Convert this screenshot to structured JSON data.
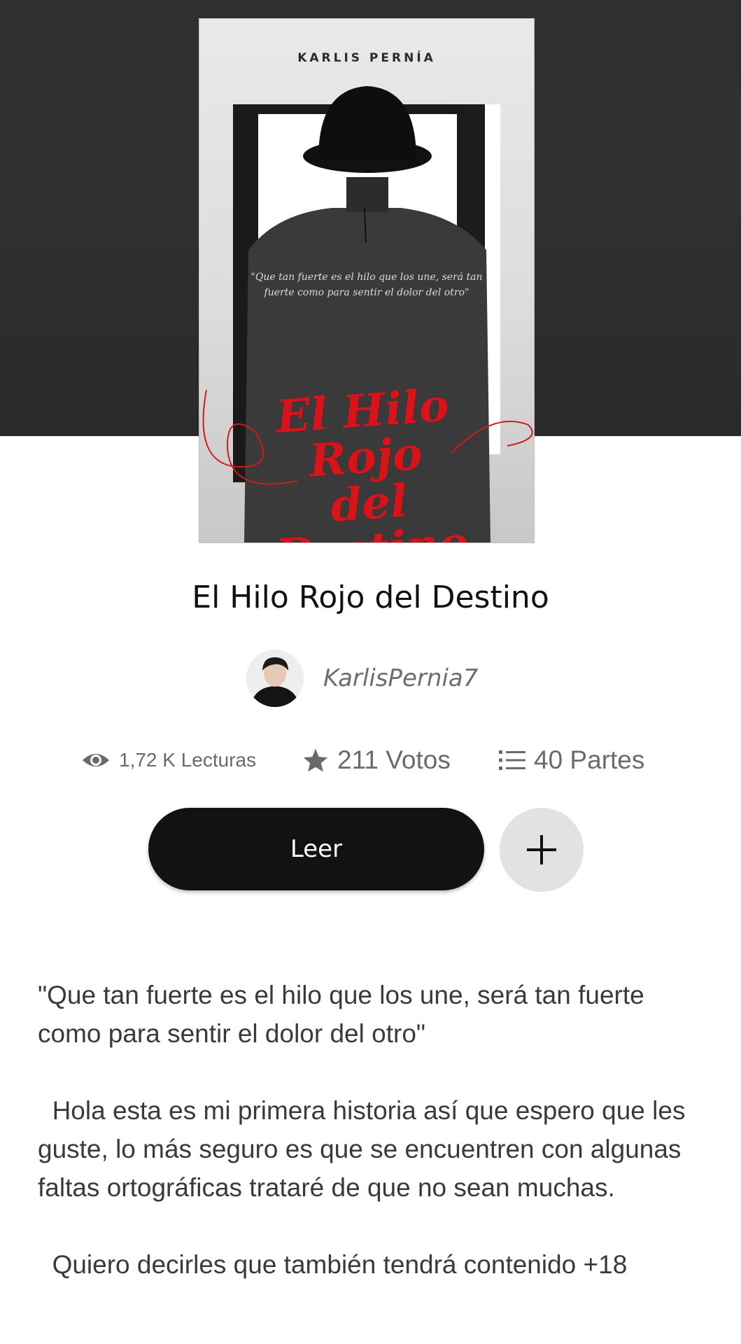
{
  "colors": {
    "header_background": "#2f2f2f",
    "read_button": "#121212",
    "add_button": "#e2e2e2",
    "cover_title_red": "#d8141b",
    "stat_text": "#6a6a6a"
  },
  "cover": {
    "author": "KARLIS PERNÍA",
    "quote": "\"Que tan fuerte es el hilo que los une, será tan fuerte como para sentir el dolor del otro\"",
    "title_line1": "El Hilo Rojo",
    "title_line2": "del Destino"
  },
  "story": {
    "title": "El Hilo Rojo del Destino",
    "author": "KarlisPernia7"
  },
  "stats": {
    "reads": "1,72 K Lecturas",
    "votes": "211 Votos",
    "parts": "40 Partes",
    "icons": [
      "eye-icon",
      "star-icon",
      "list-icon"
    ]
  },
  "actions": {
    "read_label": "Leer",
    "add_icon": "plus-icon"
  },
  "description": {
    "paragraphs": [
      "\"Que tan fuerte es el hilo que los une, será tan fuerte como para sentir el dolor del otro\"",
      "  Hola esta es mi primera historia así que espero que les guste, lo más seguro es que se encuentren con algunas faltas ortográficas trataré de que no sean muchas.",
      "  Quiero decirles que también tendrá contenido +18"
    ]
  }
}
